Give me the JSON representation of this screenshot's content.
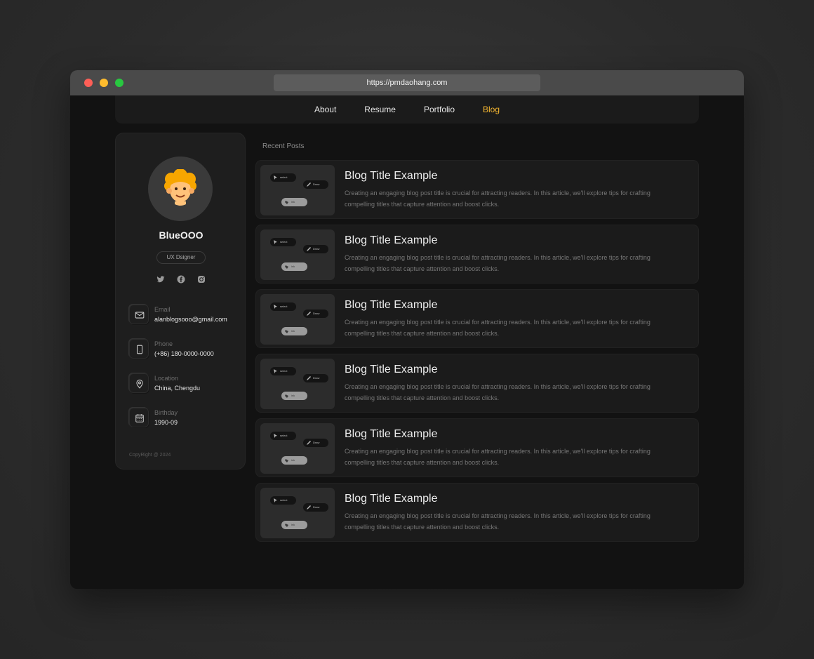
{
  "browser": {
    "url": "https://pmdaohang.com"
  },
  "nav": {
    "items": [
      {
        "label": "About"
      },
      {
        "label": "Resume"
      },
      {
        "label": "Portfolio"
      },
      {
        "label": "Blog"
      }
    ],
    "active_color": "#f5b731"
  },
  "profile": {
    "name": "BlueOOO",
    "role": "UX Dsigner",
    "socials": [
      "twitter-icon",
      "facebook-icon",
      "instagram-icon"
    ],
    "contacts": [
      {
        "label": "Email",
        "value": "alanblogsooo@gmail.com",
        "icon": "mail-icon"
      },
      {
        "label": "Phone",
        "value": "(+86) 180-0000-0000",
        "icon": "phone-icon"
      },
      {
        "label": "Location",
        "value": "China, Chengdu",
        "icon": "location-icon"
      },
      {
        "label": "Birthday",
        "value": "1990-09",
        "icon": "calendar-icon"
      }
    ],
    "copyright": "CopyRight @ 2024"
  },
  "posts_section": {
    "title": "Recent Posts"
  },
  "posts": [
    {
      "title": "Blog Title Example",
      "excerpt": "Creating an engaging blog post title is crucial for attracting readers. In this article, we'll explore tips for crafting compelling titles that capture attention and boost clicks.",
      "thumb": {
        "p1": "select",
        "p2": "Draw",
        "p3": "ink"
      }
    },
    {
      "title": "Blog Title Example",
      "excerpt": "Creating an engaging blog post title is crucial for attracting readers. In this article, we'll explore tips for crafting compelling titles that capture attention and boost clicks.",
      "thumb": {
        "p1": "select",
        "p2": "Draw",
        "p3": "ink"
      }
    },
    {
      "title": "Blog Title Example",
      "excerpt": "Creating an engaging blog post title is crucial for attracting readers. In this article, we'll explore tips for crafting compelling titles that capture attention and boost clicks.",
      "thumb": {
        "p1": "select",
        "p2": "Draw",
        "p3": "ink"
      }
    },
    {
      "title": "Blog Title Example",
      "excerpt": "Creating an engaging blog post title is crucial for attracting readers. In this article, we'll explore tips for crafting compelling titles that capture attention and boost clicks.",
      "thumb": {
        "p1": "select",
        "p2": "Draw",
        "p3": "ink"
      }
    },
    {
      "title": "Blog Title Example",
      "excerpt": "Creating an engaging blog post title is crucial for attracting readers. In this article, we'll explore tips for crafting compelling titles that capture attention and boost clicks.",
      "thumb": {
        "p1": "select",
        "p2": "Draw",
        "p3": "ink"
      }
    },
    {
      "title": "Blog Title Example",
      "excerpt": "Creating an engaging blog post title is crucial for attracting readers. In this article, we'll explore tips for crafting compelling titles that capture attention and boost clicks.",
      "thumb": {
        "p1": "select",
        "p2": "Draw",
        "p3": "ink"
      }
    }
  ]
}
